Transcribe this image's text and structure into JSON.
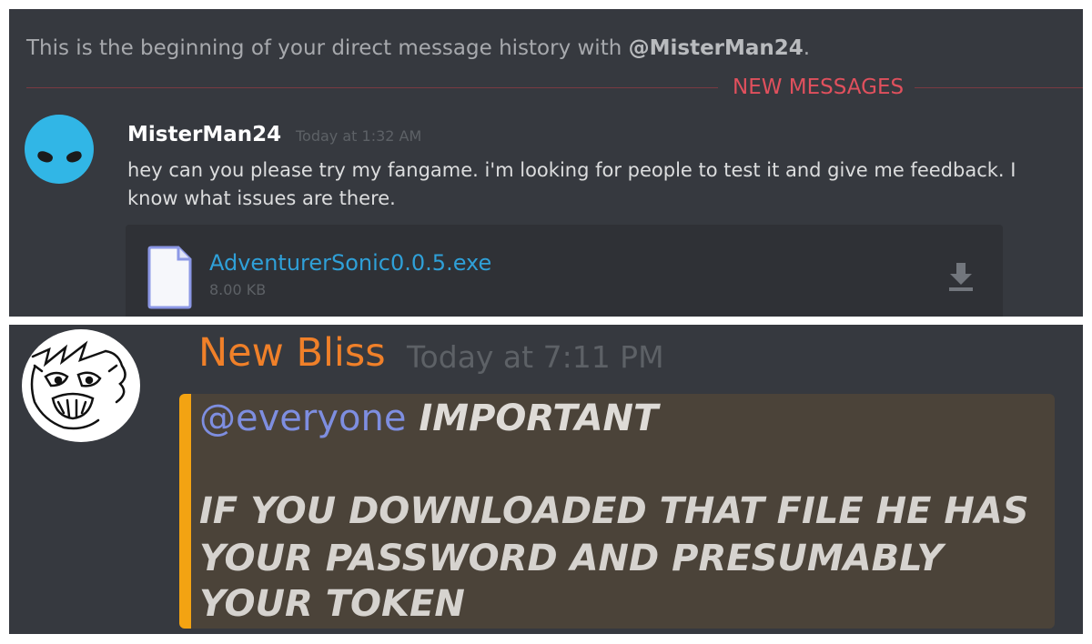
{
  "top": {
    "intro_prefix": "This is the beginning of your direct message history with ",
    "intro_mention": "@MisterMan24",
    "intro_suffix": ".",
    "divider_label": "NEW MESSAGES",
    "message": {
      "author": "MisterMan24",
      "timestamp": "Today at 1:32 AM",
      "line1": "hey can  you please try my fangame.  i'm looking for people to test it and give me feedback. I",
      "line2": "know what issues are there."
    },
    "attachment": {
      "filename": "AdventurerSonic0.0.5.exe",
      "size": "8.00 KB",
      "icon": "file-icon",
      "action_icon": "download-icon"
    }
  },
  "bottom": {
    "message": {
      "author": "New Bliss",
      "timestamp": "Today at 7:11 PM",
      "mention": "@everyone",
      "important": "IMPORTANT",
      "body_lines": [
        "IF YOU DOWNLOADED THAT FILE HE HAS",
        "YOUR PASSWORD AND PRESUMABLY",
        "YOUR TOKEN"
      ]
    }
  },
  "colors": {
    "background": "#36393f",
    "new_messages": "#e0505d",
    "link": "#2fa0d8",
    "author_orange": "#f08029",
    "mention": "#7e8ee0",
    "quote_bar": "#f3a312"
  }
}
